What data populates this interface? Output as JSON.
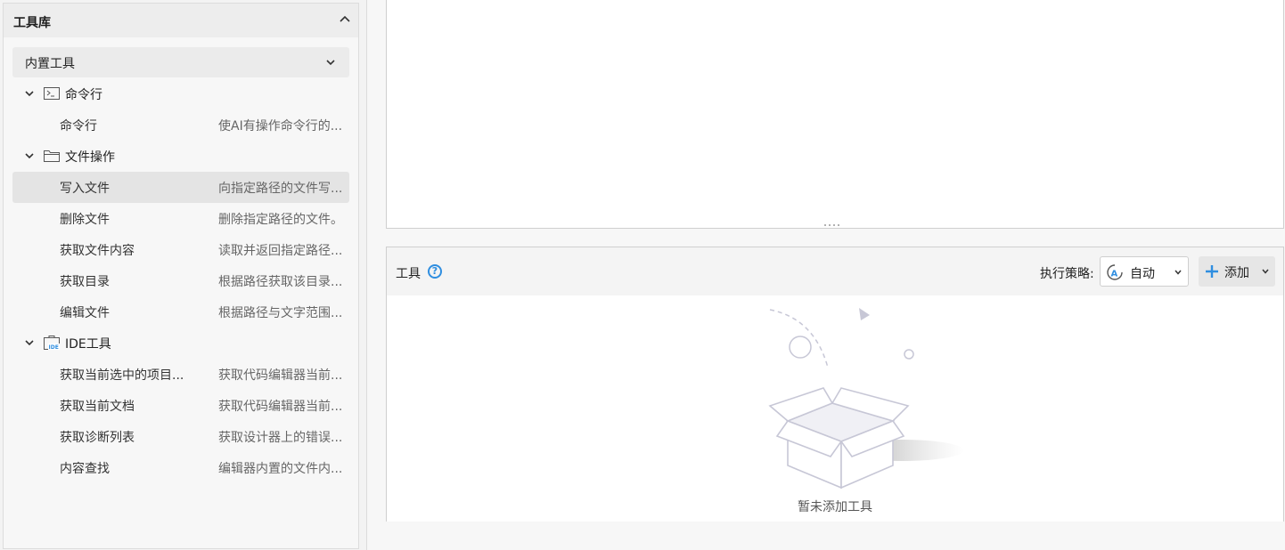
{
  "library": {
    "title": "工具库",
    "group": "内置工具",
    "categories": [
      {
        "label": "命令行",
        "icon": "terminal-icon",
        "tools": [
          {
            "name": "命令行",
            "desc": "使AI有操作命令行的..."
          }
        ]
      },
      {
        "label": "文件操作",
        "icon": "folder-icon",
        "tools": [
          {
            "name": "写入文件",
            "desc": "向指定路径的文件写..."
          },
          {
            "name": "删除文件",
            "desc": "删除指定路径的文件。"
          },
          {
            "name": "获取文件内容",
            "desc": "读取并返回指定路径..."
          },
          {
            "name": "获取目录",
            "desc": "根据路径获取该目录..."
          },
          {
            "name": "编辑文件",
            "desc": "根据路径与文字范围..."
          }
        ]
      },
      {
        "label": "IDE工具",
        "icon": "ide-toolbox-icon",
        "tools": [
          {
            "name": "获取当前选中的项目...",
            "desc": "获取代码编辑器当前..."
          },
          {
            "name": "获取当前文档",
            "desc": "获取代码编辑器当前..."
          },
          {
            "name": "获取诊断列表",
            "desc": "获取设计器上的错误..."
          },
          {
            "name": "内容查找",
            "desc": "编辑器内置的文件内..."
          }
        ]
      }
    ]
  },
  "tools_panel": {
    "title": "工具",
    "strategy_label": "执行策略:",
    "strategy_value": "自动",
    "add_label": "添加",
    "empty_text": "暂未添加工具"
  },
  "colors": {
    "accent": "#2f8ee0",
    "selected_row": "#e4e4e4"
  }
}
